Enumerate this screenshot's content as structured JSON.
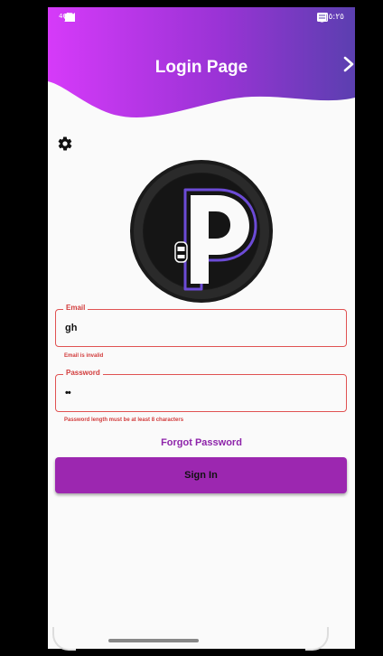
{
  "status_bar": {
    "network_label": "4G",
    "time": "٥:٢٥"
  },
  "header": {
    "title": "Login Page",
    "next_icon": "chevron-right-icon",
    "gradient_start": "#d63af9",
    "gradient_end": "#5b3fb0"
  },
  "settings_icon": "gear-icon",
  "form": {
    "email": {
      "label": "Email",
      "value": "gh",
      "error": "Email is invalid"
    },
    "password": {
      "label": "Password",
      "value": "••",
      "error": "Password length must be at least 8 characters"
    },
    "forgot_label": "Forgot Password",
    "signin_label": "Sign In"
  },
  "colors": {
    "error": "#d23c3c",
    "primary": "#9c27b0",
    "accent_text": "#8e24aa"
  }
}
